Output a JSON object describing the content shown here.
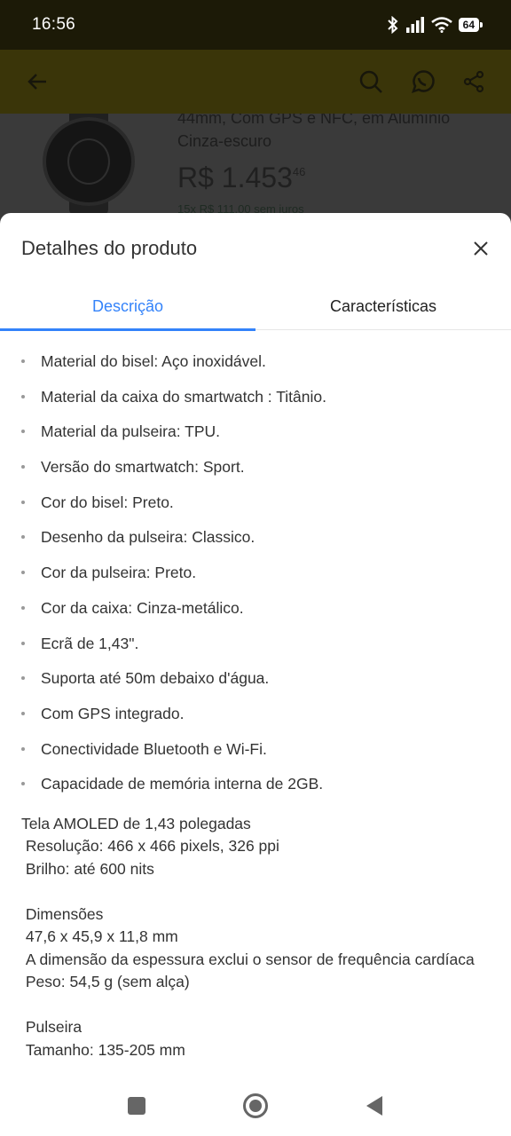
{
  "status_bar": {
    "time": "16:56",
    "battery": "64"
  },
  "background_product": {
    "title": "44mm, Com GPS e NFC, em Alumínio Cinza-escuro",
    "price_main": "R$ 1.453",
    "price_cents": "46",
    "installments": "15x R$ 111,00 sem juros"
  },
  "sheet": {
    "title": "Detalhes do produto",
    "tabs": [
      {
        "label": "Descrição",
        "active": true
      },
      {
        "label": "Características",
        "active": false
      }
    ],
    "bullets": [
      "Material do bisel: Aço inoxidável.",
      "Material da caixa do smartwatch : Titânio.",
      "Material da pulseira: TPU.",
      "Versão do smartwatch: Sport.",
      "Cor do bisel: Preto.",
      "Desenho da pulseira: Classico.",
      "Cor da pulseira: Preto.",
      "Cor da caixa: Cinza-metálico.",
      "Ecrã de 1,43\".",
      "Suporta até 50m debaixo d'água.",
      "Com GPS integrado.",
      "Conectividade Bluetooth e Wi-Fi.",
      "Capacidade de memória interna de 2GB."
    ],
    "description_text": "Tela AMOLED de 1,43 polegadas\n Resolução: 466 x 466 pixels, 326 ppi\n Brilho: até 600 nits\n\n Dimensões\n 47,6 x 45,9 x 11,8 mm\n A dimensão da espessura exclui o sensor de frequência cardíaca\n Peso: 54,5 g (sem alça)\n\n Pulseira\n Tamanho: 135-205 mm"
  },
  "colors": {
    "accent": "#3483fa",
    "text": "#333333",
    "overlay": "#3a3509"
  },
  "icons": [
    "back-arrow-icon",
    "search-icon",
    "whatsapp-icon",
    "share-icon",
    "close-icon",
    "bluetooth-icon",
    "signal-icon",
    "wifi-icon"
  ]
}
